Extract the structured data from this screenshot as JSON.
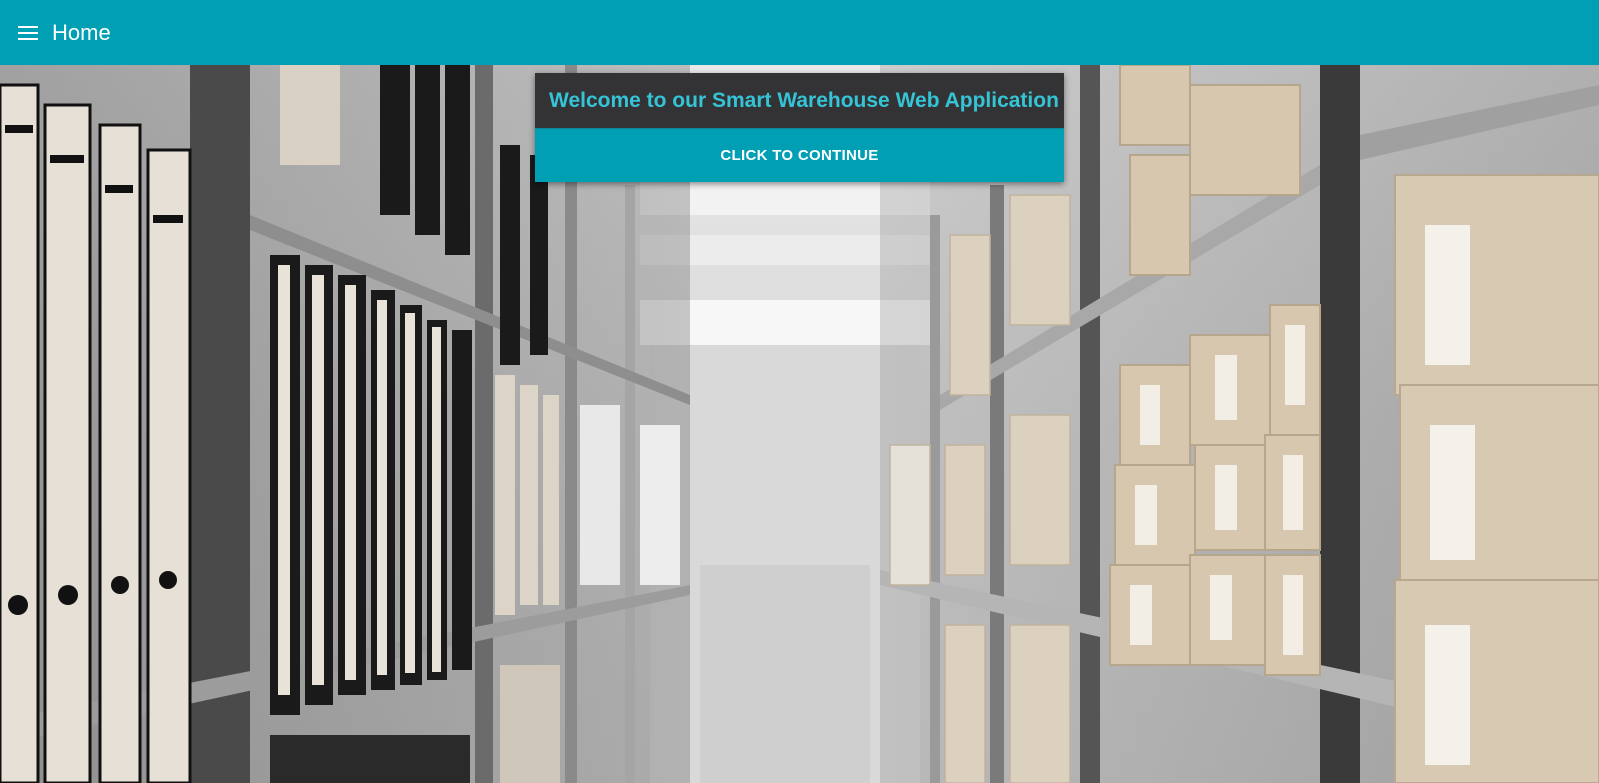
{
  "appbar": {
    "title": "Home",
    "menu_icon": "hamburger-menu-icon",
    "background_color": "#009fb3"
  },
  "welcome_card": {
    "title": "Welcome to our Smart Warehouse Web Application",
    "title_color": "#35c4d6",
    "header_color": "#333336",
    "button_label": "CLICK TO CONTINUE",
    "button_color": "#009fb3"
  },
  "background": {
    "description_icon": "warehouse-shelves-photo"
  }
}
